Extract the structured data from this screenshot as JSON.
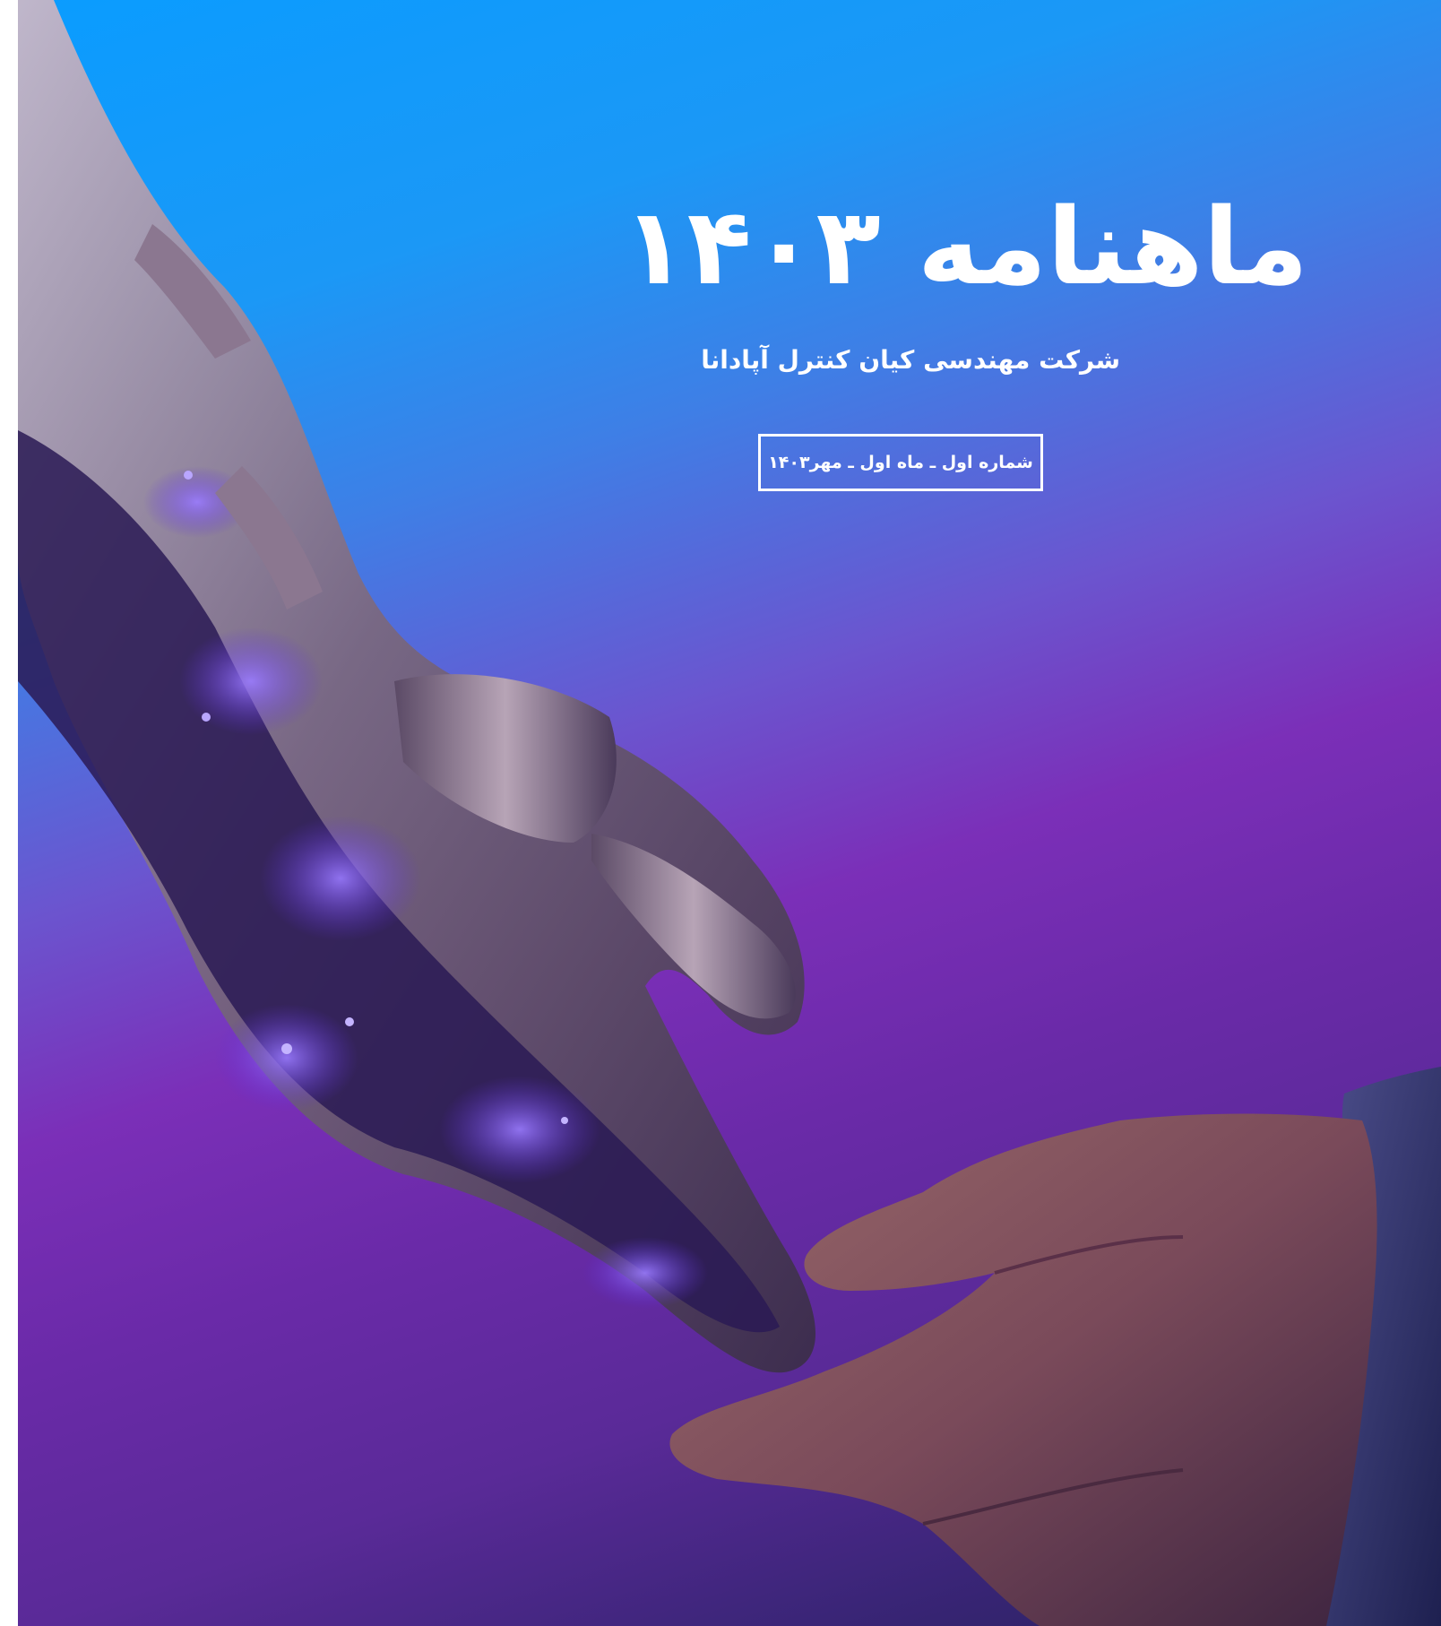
{
  "cover": {
    "title": "ماهنامه ۱۴۰۳",
    "subtitle": "شرکت مهندسی کیان کنترل آپادانا",
    "issue_label": "شماره اول ـ ماه اول ـ مهر۱۴۰۳"
  },
  "colors": {
    "gradient_top": "#0a9cff",
    "gradient_mid": "#7b2fb8",
    "gradient_bottom": "#24205a",
    "text": "#ffffff",
    "glow": "#8a5cff"
  },
  "illustration": {
    "robot_hand_icon": "robotic-hand-icon",
    "human_hand_icon": "human-hand-icon"
  }
}
